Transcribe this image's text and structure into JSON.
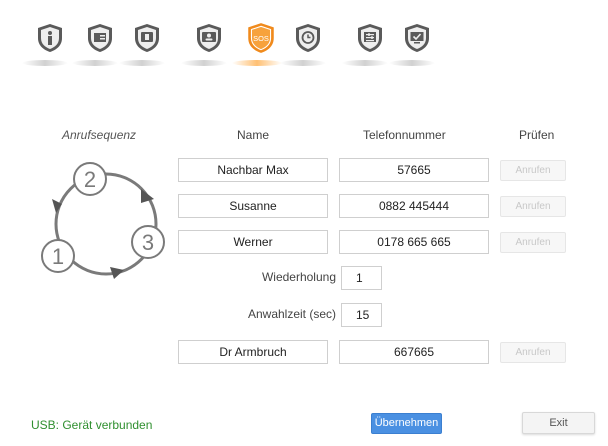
{
  "toolbar": {
    "items": [
      {
        "icon": "info-icon"
      },
      {
        "icon": "contact-card-icon"
      },
      {
        "icon": "phone-book-icon"
      },
      {
        "icon": "contacts-icon"
      },
      {
        "icon": "sos-icon",
        "label": "SOS",
        "active": true
      },
      {
        "icon": "alarm-clock-icon"
      },
      {
        "icon": "settings-sliders-icon"
      },
      {
        "icon": "screen-check-icon"
      }
    ],
    "active_color": "#f08a1c",
    "inactive_color": "#5a5a5a"
  },
  "sequence": {
    "title": "Anrufsequenz",
    "steps": [
      "1",
      "2",
      "3"
    ]
  },
  "columns": {
    "name": "Name",
    "phone": "Telefonnummer",
    "check": "Prüfen"
  },
  "contacts": [
    {
      "name": "Nachbar Max",
      "phone": "57665",
      "button": "Anrufen"
    },
    {
      "name": "Susanne",
      "phone": "0882 445444",
      "button": "Anrufen"
    },
    {
      "name": "Werner",
      "phone": "0178 665 665",
      "button": "Anrufen"
    }
  ],
  "repeat": {
    "label": "Wiederholung",
    "value": "1"
  },
  "dial_time": {
    "label": "Anwahlzeit (sec)",
    "value": "15"
  },
  "extra_contact": {
    "name": "Dr Armbruch",
    "phone": "667665",
    "button": "Anrufen"
  },
  "status": {
    "text": "USB: Gerät verbunden",
    "color": "#2f8f2f"
  },
  "actions": {
    "apply": "Übernehmen",
    "exit": "Exit"
  }
}
